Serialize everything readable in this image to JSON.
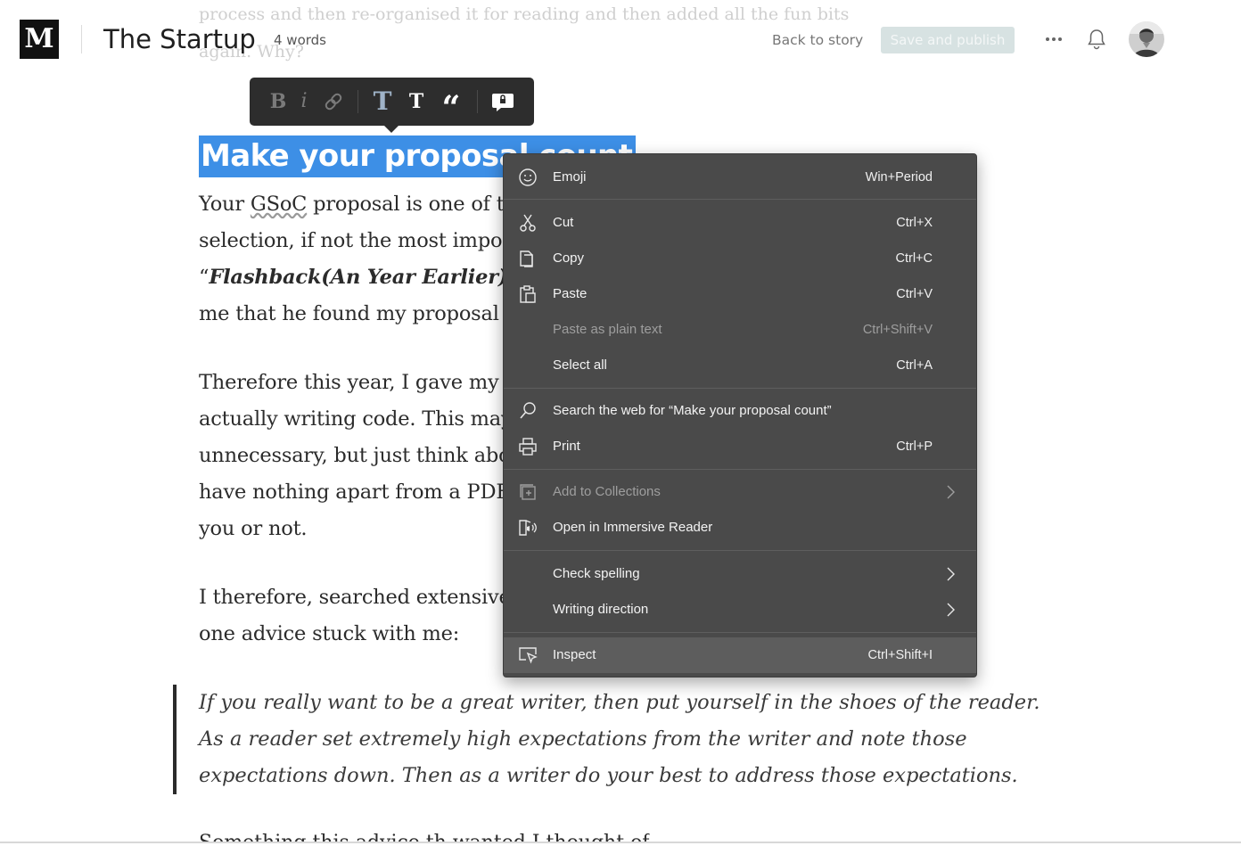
{
  "header": {
    "logo": "M",
    "publication": "The Startup",
    "word_count": "4 words",
    "back_link": "Back to story",
    "save_button": "Save and publish",
    "more_icon": "more-dots-icon",
    "bell_icon": "bell-icon"
  },
  "ghost_text": {
    "line1": "process and then re-organised it for reading and then added all the fun bits",
    "line2": "again. Why?"
  },
  "format_toolbar": {
    "bold": "B",
    "italic": "i",
    "big_title": "T",
    "small_title": "T",
    "quote": "“"
  },
  "article": {
    "heading": "Make your proposal count",
    "p1": {
      "l1_pre": "Your ",
      "l1_gsoc": "GSoC",
      "l1_post": " proposal is one of th",
      "l2": "selection, if not the most impor",
      "l3_open": "“",
      "l3_ital": "Flashback(An Year Earlier)",
      "l3_close": "”",
      "l4": "me that he found my proposal"
    },
    "p2": [
      "Therefore this year, I gave my p",
      "actually writing code. This may",
      "unnecessary, but just think abo",
      "have nothing apart from a PDF",
      "you or not."
    ],
    "p3": [
      "I therefore, searched extensive",
      "one advice stuck with me:"
    ],
    "quote": [
      "If you really want to be a great writer, then put yourself in the shoes of the reader.",
      "As a reader set extremely high expectations from the writer and note those",
      "expectations down. Then as a writer do your best to address those expectations."
    ],
    "bottom_peek": "Something this advice th                 wanted I thought of"
  },
  "context_menu": {
    "items": [
      {
        "icon": "emoji-icon",
        "label": "Emoji",
        "shortcut": "Win+Period"
      },
      {
        "icon": "scissors-icon",
        "label": "Cut",
        "shortcut": "Ctrl+X"
      },
      {
        "icon": "copy-icon",
        "label": "Copy",
        "shortcut": "Ctrl+C"
      },
      {
        "icon": "paste-icon",
        "label": "Paste",
        "shortcut": "Ctrl+V"
      },
      {
        "icon": "",
        "label": "Paste as plain text",
        "shortcut": "Ctrl+Shift+V",
        "disabled": true
      },
      {
        "icon": "",
        "label": "Select all",
        "shortcut": "Ctrl+A"
      },
      {
        "icon": "search-icon",
        "label": "Search the web for “Make your proposal count”",
        "shortcut": ""
      },
      {
        "icon": "print-icon",
        "label": "Print",
        "shortcut": "Ctrl+P"
      },
      {
        "icon": "collections-icon",
        "label": "Add to Collections",
        "shortcut": "",
        "submenu": true,
        "disabled": true
      },
      {
        "icon": "immersive-reader-icon",
        "label": "Open in Immersive Reader",
        "shortcut": ""
      },
      {
        "icon": "",
        "label": "Check spelling",
        "shortcut": "",
        "submenu": true
      },
      {
        "icon": "",
        "label": "Writing direction",
        "shortcut": "",
        "submenu": true
      },
      {
        "icon": "inspect-icon",
        "label": "Inspect",
        "shortcut": "Ctrl+Shift+I",
        "highlighted": true
      }
    ]
  },
  "colors": {
    "selection": "#3d8fe6",
    "menu_bg": "#4a4a4a",
    "toolbar_bg": "#2d2d2d"
  }
}
